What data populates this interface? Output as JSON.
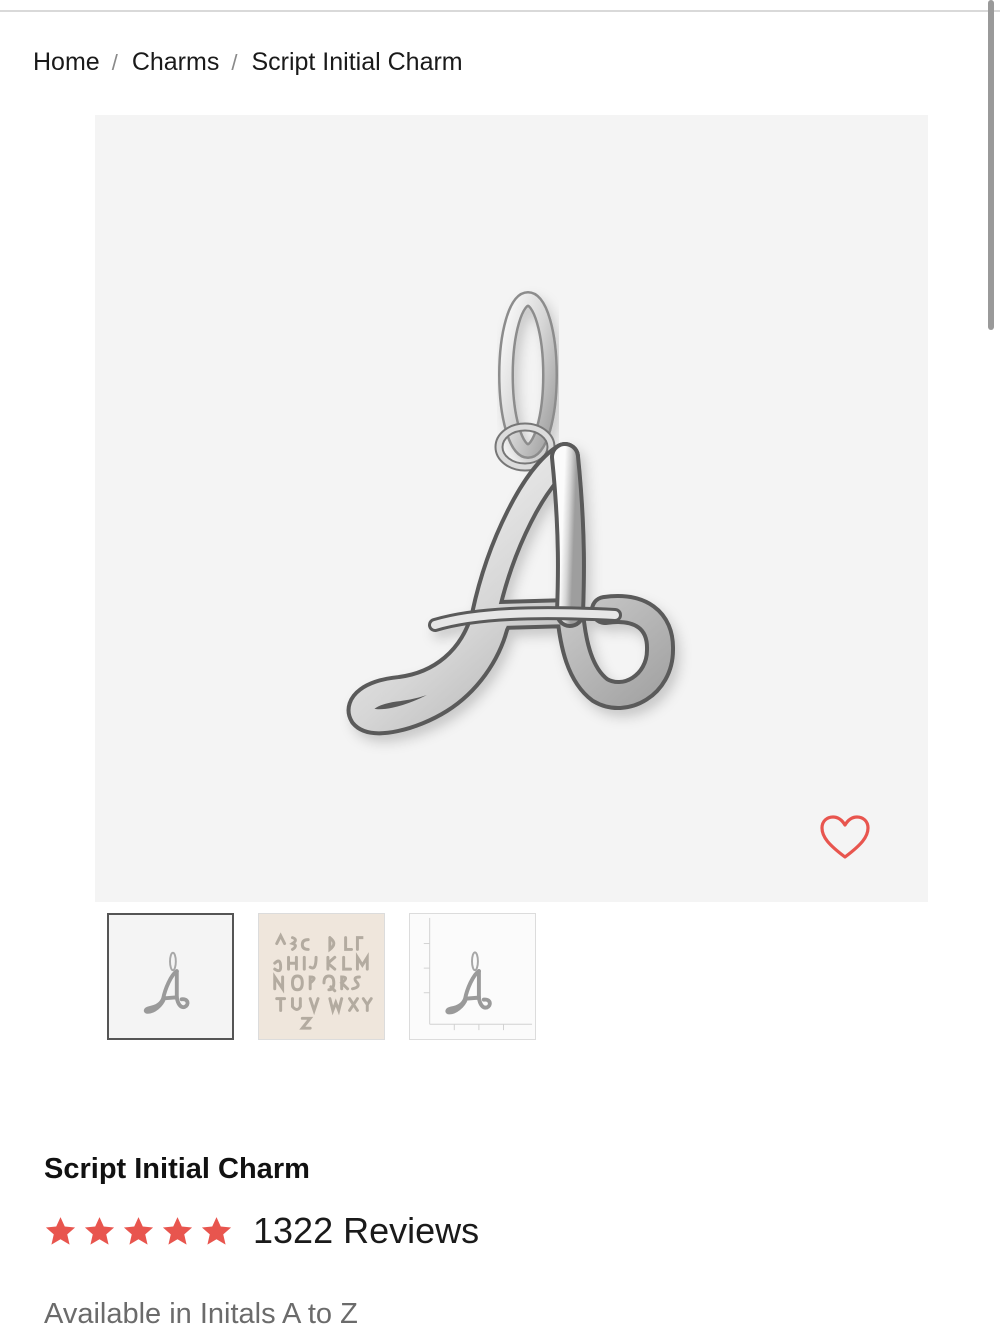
{
  "breadcrumb": {
    "items": [
      {
        "label": "Home"
      },
      {
        "label": "Charms"
      },
      {
        "label": "Script Initial Charm"
      }
    ],
    "separator": "/"
  },
  "product": {
    "title": "Script Initial Charm",
    "rating": 5,
    "rating_max": 5,
    "reviews_label": "1322 Reviews",
    "availability": "Available in Initals A to Z"
  },
  "gallery": {
    "images": [
      {
        "name": "charm-a-front",
        "active": true
      },
      {
        "name": "all-initials-set",
        "active": false
      },
      {
        "name": "charm-size-ruler",
        "active": false
      }
    ]
  },
  "icons": {
    "wishlist": "heart-icon",
    "star": "star-icon"
  },
  "colors": {
    "accent": "#e8554e",
    "star": "#e8554e",
    "hero_background": "#f4f4f4"
  }
}
